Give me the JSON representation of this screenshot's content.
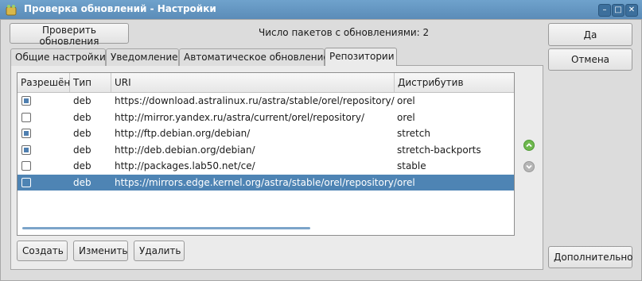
{
  "window": {
    "title": "Проверка обновлений - Настройки",
    "minimize_glyph": "–",
    "maximize_glyph": "□",
    "close_glyph": "✕"
  },
  "toolbar": {
    "check_updates_label": "Проверить обновления",
    "status_text": "Число пакетов с обновлениями: 2"
  },
  "side_buttons": {
    "ok_label": "Да",
    "cancel_label": "Отмена",
    "advanced_label": "Дополнительно"
  },
  "tabs": [
    {
      "label": "Общие настройки"
    },
    {
      "label": "Уведомление"
    },
    {
      "label": "Автоматическое обновление"
    },
    {
      "label": "Репозитории"
    }
  ],
  "active_tab": "Репозитории",
  "table": {
    "columns": [
      "Разрешён",
      "Тип",
      "URI",
      "Дистрибутив"
    ],
    "rows": [
      {
        "enabled": true,
        "type": "deb",
        "uri": "https://download.astralinux.ru/astra/stable/orel/repository/",
        "dist": "orel"
      },
      {
        "enabled": false,
        "type": "deb",
        "uri": "http://mirror.yandex.ru/astra/current/orel/repository/",
        "dist": "orel"
      },
      {
        "enabled": true,
        "type": "deb",
        "uri": "http://ftp.debian.org/debian/",
        "dist": "stretch"
      },
      {
        "enabled": true,
        "type": "deb",
        "uri": "http://deb.debian.org/debian/",
        "dist": "stretch-backports"
      },
      {
        "enabled": false,
        "type": "deb",
        "uri": "http://packages.lab50.net/ce/",
        "dist": "stable"
      },
      {
        "enabled": false,
        "type": "deb",
        "uri": "https://mirrors.edge.kernel.org/astra/stable/orel/repository/",
        "dist": "orel",
        "selected": true
      }
    ]
  },
  "bottom_buttons": {
    "create_label": "Создать",
    "edit_label": "Изменить",
    "delete_label": "Удалить"
  },
  "icons": {
    "move_up": "chevron-up-icon",
    "move_down": "chevron-down-icon"
  },
  "colors": {
    "titlebar": "#5b8cb8",
    "selection": "#4e84b4",
    "move_up": "#6fb84e"
  }
}
